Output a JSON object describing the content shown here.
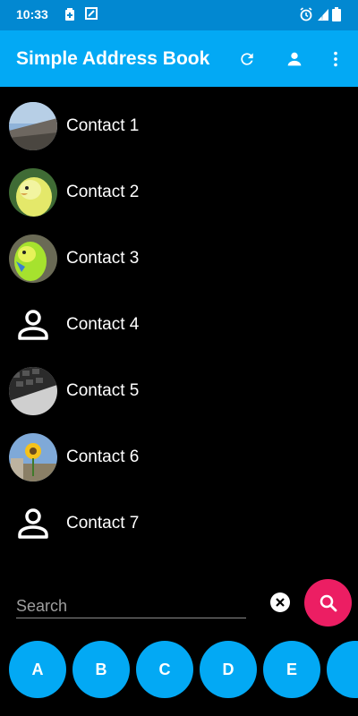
{
  "status_bar": {
    "time": "10:33",
    "icons": [
      "battery-saver-icon",
      "screenshot-icon",
      "alarm-icon",
      "signal-icon",
      "battery-icon"
    ]
  },
  "app_bar": {
    "title": "Simple Address Book",
    "actions": [
      "refresh-icon",
      "person-icon",
      "more-vert-icon"
    ],
    "color": "#03a9f4"
  },
  "contacts": [
    {
      "name": "Contact 1",
      "avatar": "photo-building"
    },
    {
      "name": "Contact 2",
      "avatar": "photo-parakeet-yellow"
    },
    {
      "name": "Contact 3",
      "avatar": "photo-parakeet-green"
    },
    {
      "name": "Contact 4",
      "avatar": "person-outline-icon"
    },
    {
      "name": "Contact 5",
      "avatar": "photo-keyboard"
    },
    {
      "name": "Contact 6",
      "avatar": "photo-sunflower"
    },
    {
      "name": "Contact 7",
      "avatar": "person-outline-icon"
    }
  ],
  "search": {
    "placeholder": "Search",
    "value": "",
    "fab_color": "#ec1e63"
  },
  "letters": [
    "A",
    "B",
    "C",
    "D",
    "E",
    ""
  ]
}
